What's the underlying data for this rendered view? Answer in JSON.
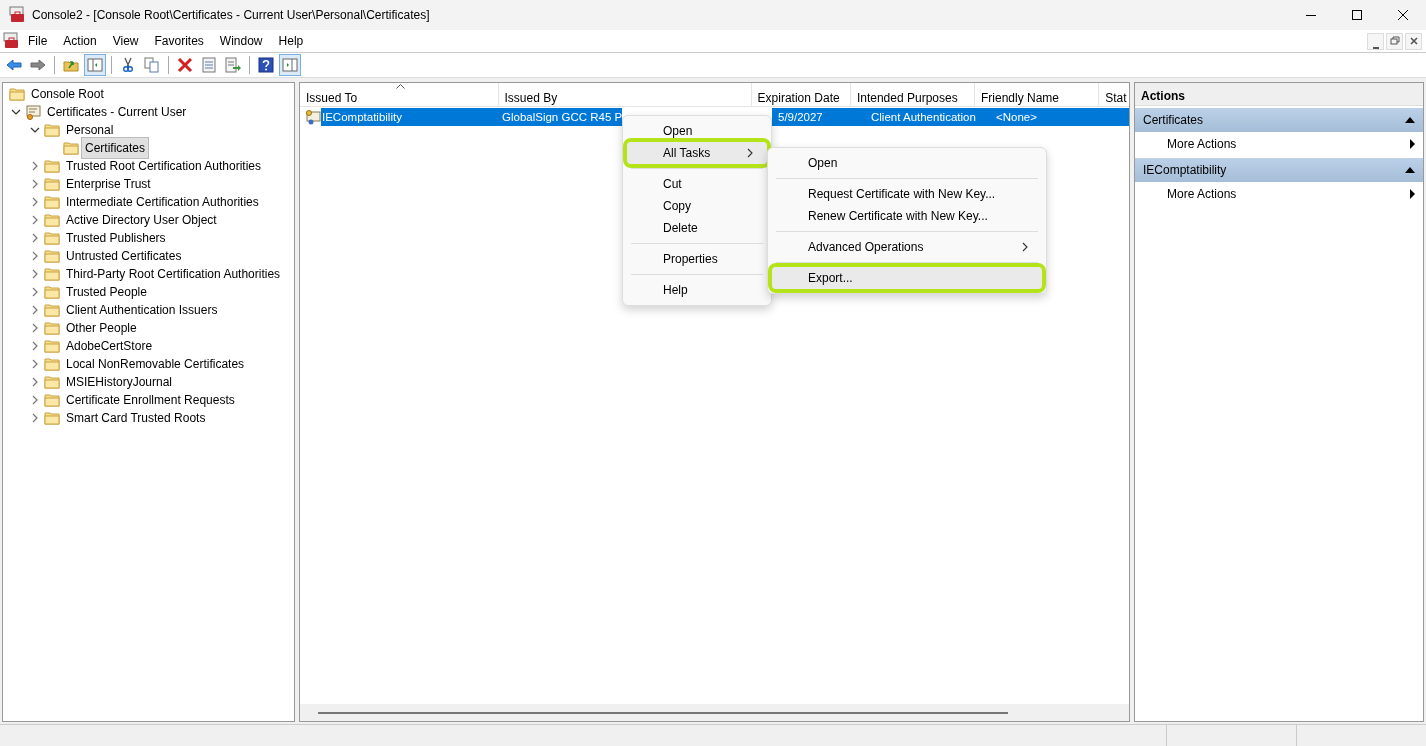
{
  "window": {
    "title": "Console2 - [Console Root\\Certificates - Current User\\Personal\\Certificates]"
  },
  "menu_bar": [
    "File",
    "Action",
    "View",
    "Favorites",
    "Window",
    "Help"
  ],
  "toolbar": [
    {
      "kind": "back",
      "pressed": false
    },
    {
      "kind": "forward",
      "pressed": false
    },
    {
      "kind": "sep"
    },
    {
      "kind": "up",
      "pressed": false
    },
    {
      "kind": "tree",
      "pressed": true
    },
    {
      "kind": "sep"
    },
    {
      "kind": "cut",
      "pressed": false
    },
    {
      "kind": "copy",
      "pressed": false
    },
    {
      "kind": "sep"
    },
    {
      "kind": "delete",
      "pressed": false
    },
    {
      "kind": "properties",
      "pressed": false
    },
    {
      "kind": "export",
      "pressed": false
    },
    {
      "kind": "sep"
    },
    {
      "kind": "help",
      "pressed": false
    },
    {
      "kind": "pane",
      "pressed": true
    }
  ],
  "tree": [
    {
      "label": "Console Root",
      "kind": "folder",
      "selected": false,
      "children": [
        {
          "label": "Certificates - Current User",
          "kind": "store",
          "expanded": true,
          "selected": false,
          "children": [
            {
              "label": "Personal",
              "kind": "folder",
              "expanded": true,
              "selected": false,
              "children": [
                {
                  "label": "Certificates",
                  "kind": "folder",
                  "selected": true
                }
              ]
            },
            {
              "label": "Trusted Root Certification Authorities",
              "kind": "folder",
              "expanded": false,
              "selected": false
            },
            {
              "label": "Enterprise Trust",
              "kind": "folder",
              "expanded": false,
              "selected": false
            },
            {
              "label": "Intermediate Certification Authorities",
              "kind": "folder",
              "expanded": false,
              "selected": false
            },
            {
              "label": "Active Directory User Object",
              "kind": "folder",
              "expanded": false,
              "selected": false
            },
            {
              "label": "Trusted Publishers",
              "kind": "folder",
              "expanded": false,
              "selected": false
            },
            {
              "label": "Untrusted Certificates",
              "kind": "folder",
              "expanded": false,
              "selected": false
            },
            {
              "label": "Third-Party Root Certification Authorities",
              "kind": "folder",
              "expanded": false,
              "selected": false
            },
            {
              "label": "Trusted People",
              "kind": "folder",
              "expanded": false,
              "selected": false
            },
            {
              "label": "Client Authentication Issuers",
              "kind": "folder",
              "expanded": false,
              "selected": false
            },
            {
              "label": "Other People",
              "kind": "folder",
              "expanded": false,
              "selected": false
            },
            {
              "label": "AdobeCertStore",
              "kind": "folder",
              "expanded": false,
              "selected": false
            },
            {
              "label": "Local NonRemovable Certificates",
              "kind": "folder",
              "expanded": false,
              "selected": false
            },
            {
              "label": "MSIEHistoryJournal",
              "kind": "folder",
              "expanded": false,
              "selected": false
            },
            {
              "label": "Certificate Enrollment Requests",
              "kind": "folder",
              "expanded": false,
              "selected": false
            },
            {
              "label": "Smart Card Trusted Roots",
              "kind": "folder",
              "expanded": false,
              "selected": false
            }
          ]
        }
      ]
    }
  ],
  "table": {
    "columns": [
      {
        "label": "Issued To",
        "sorted": true
      },
      {
        "label": "Issued By",
        "sorted": false
      },
      {
        "label": "Expiration Date",
        "sorted": false
      },
      {
        "label": "Intended Purposes",
        "sorted": false
      },
      {
        "label": "Friendly Name",
        "sorted": false
      },
      {
        "label": "Stat",
        "sorted": false
      }
    ],
    "rows": [
      {
        "selected": true,
        "cells": [
          "IEComptatibility",
          "GlobalSign GCC R45 P",
          "5/9/2027",
          "Client Authentication",
          "<None>"
        ]
      }
    ]
  },
  "context_menu": {
    "items": [
      {
        "kind": "item",
        "label": "Open",
        "highlighted": false
      },
      {
        "kind": "submenu",
        "label": "All Tasks",
        "highlighted": true
      },
      {
        "kind": "sep"
      },
      {
        "kind": "item",
        "label": "Cut",
        "highlighted": false
      },
      {
        "kind": "item",
        "label": "Copy",
        "highlighted": false
      },
      {
        "kind": "item",
        "label": "Delete",
        "highlighted": false
      },
      {
        "kind": "sep"
      },
      {
        "kind": "item",
        "label": "Properties",
        "highlighted": false
      },
      {
        "kind": "sep"
      },
      {
        "kind": "item",
        "label": "Help",
        "highlighted": false
      }
    ],
    "submenu": [
      {
        "kind": "item",
        "label": "Open",
        "highlighted": false
      },
      {
        "kind": "sep"
      },
      {
        "kind": "item",
        "label": "Request Certificate with New Key...",
        "highlighted": false
      },
      {
        "kind": "item",
        "label": "Renew Certificate with New Key...",
        "highlighted": false
      },
      {
        "kind": "sep"
      },
      {
        "kind": "submenu",
        "label": "Advanced Operations",
        "highlighted": false
      },
      {
        "kind": "sep"
      },
      {
        "kind": "item",
        "label": "Export...",
        "highlighted": true
      }
    ]
  },
  "actions": {
    "title": "Actions",
    "sections": [
      {
        "title": "Certificates",
        "items": [
          "More Actions"
        ]
      },
      {
        "title": "IEComptatibility",
        "items": [
          "More Actions"
        ]
      }
    ]
  }
}
